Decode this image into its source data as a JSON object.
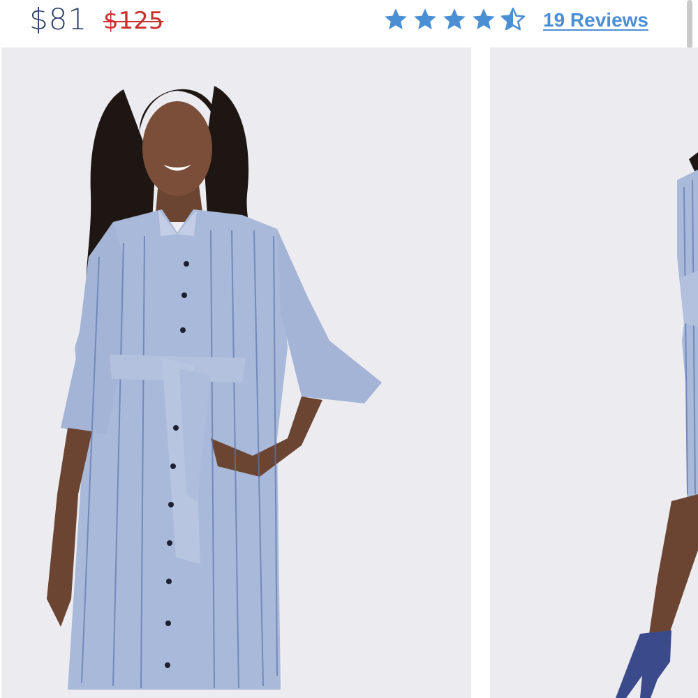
{
  "price": {
    "current": "$81",
    "original": "$125"
  },
  "rating": {
    "value": 4.5,
    "max": 5,
    "reviews_label": "19 Reviews"
  },
  "colors": {
    "price_current": "#2c3e66",
    "price_original": "#c8322e",
    "star": "#4a8fd4",
    "photo_background": "#ecebf0",
    "dress": "#a9b9d9"
  },
  "carousel": {
    "slides": [
      {
        "name": "model-front-view"
      },
      {
        "name": "model-side-view"
      }
    ]
  }
}
